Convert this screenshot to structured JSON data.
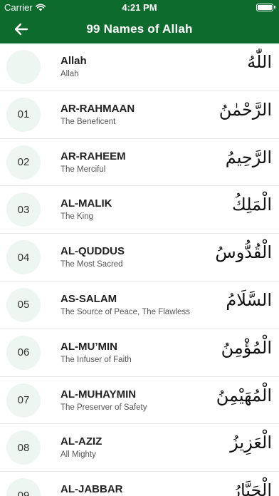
{
  "status_bar": {
    "carrier": "Carrier",
    "time": "4:21 PM"
  },
  "header": {
    "title": "99 Names of Allah",
    "back_icon": "arrow-left-icon"
  },
  "colors": {
    "header_bg": "#0e6b2e",
    "circle_bg": "#eef6f1"
  },
  "names": [
    {
      "number": "",
      "name": "Allah",
      "meaning": "Allah",
      "arabic": "اللّٰهُ"
    },
    {
      "number": "01",
      "name": "AR-RAHMAAN",
      "meaning": "The Beneficent",
      "arabic": "الرَّحْمٰنُ"
    },
    {
      "number": "02",
      "name": "AR-RAHEEM",
      "meaning": "The Merciful",
      "arabic": "الرَّحِيمُ"
    },
    {
      "number": "03",
      "name": "AL-MALIK",
      "meaning": "The King",
      "arabic": "الْمَلِكُ"
    },
    {
      "number": "04",
      "name": "AL-QUDDUS",
      "meaning": "The Most Sacred",
      "arabic": "الْقُدُّوسُ"
    },
    {
      "number": "05",
      "name": "AS-SALAM",
      "meaning": "The Source of Peace, The Flawless",
      "arabic": "السَّلَامُ"
    },
    {
      "number": "06",
      "name": "AL-MU’MIN",
      "meaning": "The Infuser of Faith",
      "arabic": "الْمُؤْمِنُ"
    },
    {
      "number": "07",
      "name": "AL-MUHAYMIN",
      "meaning": "The Preserver of Safety",
      "arabic": "الْمُهَيْمِنُ"
    },
    {
      "number": "08",
      "name": "AL-AZIZ",
      "meaning": "All Mighty",
      "arabic": "الْعَزِيزُ"
    },
    {
      "number": "09",
      "name": "AL-JABBAR",
      "meaning": "",
      "arabic": "الْجَبَّارُ"
    }
  ]
}
